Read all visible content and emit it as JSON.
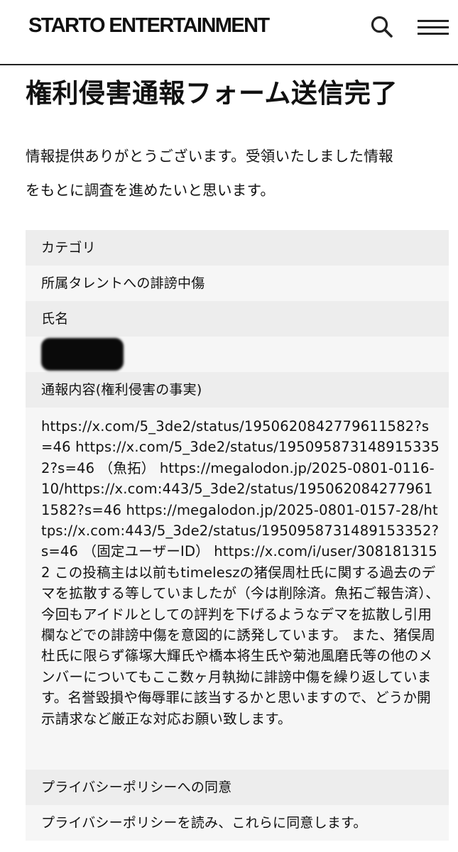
{
  "header": {
    "logo": "STARTO ENTERTAINMENT"
  },
  "page": {
    "title": "権利侵害通報フォーム送信完了",
    "intro_line1": "情報提供ありがとうございます。受領いたしました情報",
    "intro_line2": "をもとに調査を進めたいと思います。"
  },
  "fields": {
    "category_label": "カテゴリ",
    "category_value": "所属タレントへの誹謗中傷",
    "name_label": "氏名",
    "report_label": "通報内容(権利侵害の事実)",
    "report_value": "https://x.com/5_3de2/status/1950620842779611582?s=46 https://x.com/5_3de2/status/1950958731489153352?s=46 （魚拓） https://megalodon.jp/2025-0801-0116-10/https://x.com:443/5_3de2/status/1950620842779611582?s=46 https://megalodon.jp/2025-0801-0157-28/https://x.com:443/5_3de2/status/1950958731489153352?s=46 （固定ユーザーID） https://x.com/i/user/3081813152 この投稿主は以前もtimeleszの猪俣周杜氏に関する過去のデマを拡散する等していましたが（今は削除済。魚拓ご報告済）、今回もアイドルとしての評判を下げるようなデマを拡散し引用欄などでの誹謗中傷を意図的に誘発しています。 また、猪俣周杜氏に限らず篠塚大輝氏や橋本将生氏や菊池風磨氏等の他のメンバーについてもここ数ヶ月執拗に誹謗中傷を繰り返しています。名誉毀損や侮辱罪に該当するかと思いますので、どうか開示請求など厳正な対応お願い致します。",
    "privacy_label": "プライバシーポリシーへの同意",
    "privacy_value": "プライバシーポリシーを読み、これらに同意します。"
  },
  "icons": {
    "search": "search-icon",
    "menu": "hamburger-menu-icon"
  }
}
